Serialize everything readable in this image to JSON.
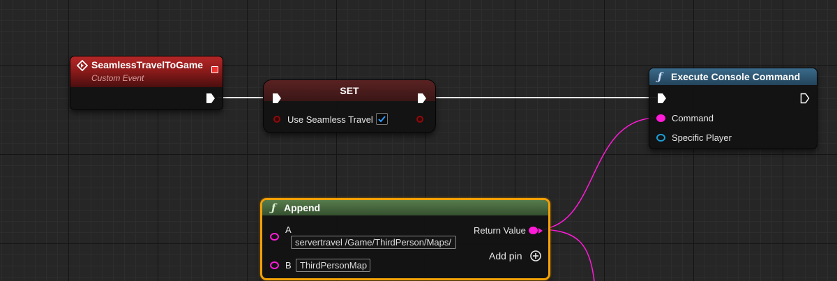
{
  "colors": {
    "string_pin": "#ff1bd8",
    "object_pin": "#1b9fd6",
    "bool_pin": "#8c0b0b",
    "event_header": "#a11d1d",
    "function_header": "#2c4f6b",
    "pure_function_header": "#3f5e36",
    "selection_outline": "#f2a007"
  },
  "custom_event": {
    "title": "SeamlessTravelToGame",
    "subtitle": "Custom Event",
    "icon": "event-diamond-icon"
  },
  "set_node": {
    "title": "SET",
    "variable_label": "Use Seamless Travel",
    "checked": true
  },
  "execute_node": {
    "title": "Execute Console Command",
    "icon": "function-icon",
    "pins": [
      "Command",
      "Specific Player"
    ]
  },
  "append_node": {
    "title": "Append",
    "icon": "function-icon",
    "pin_a_label": "A",
    "pin_a_value": "servertravel /Game/ThirdPerson/Maps/",
    "pin_b_label": "B",
    "pin_b_value": "ThirdPersonMap",
    "return_label": "Return Value",
    "add_pin_label": "Add pin"
  }
}
